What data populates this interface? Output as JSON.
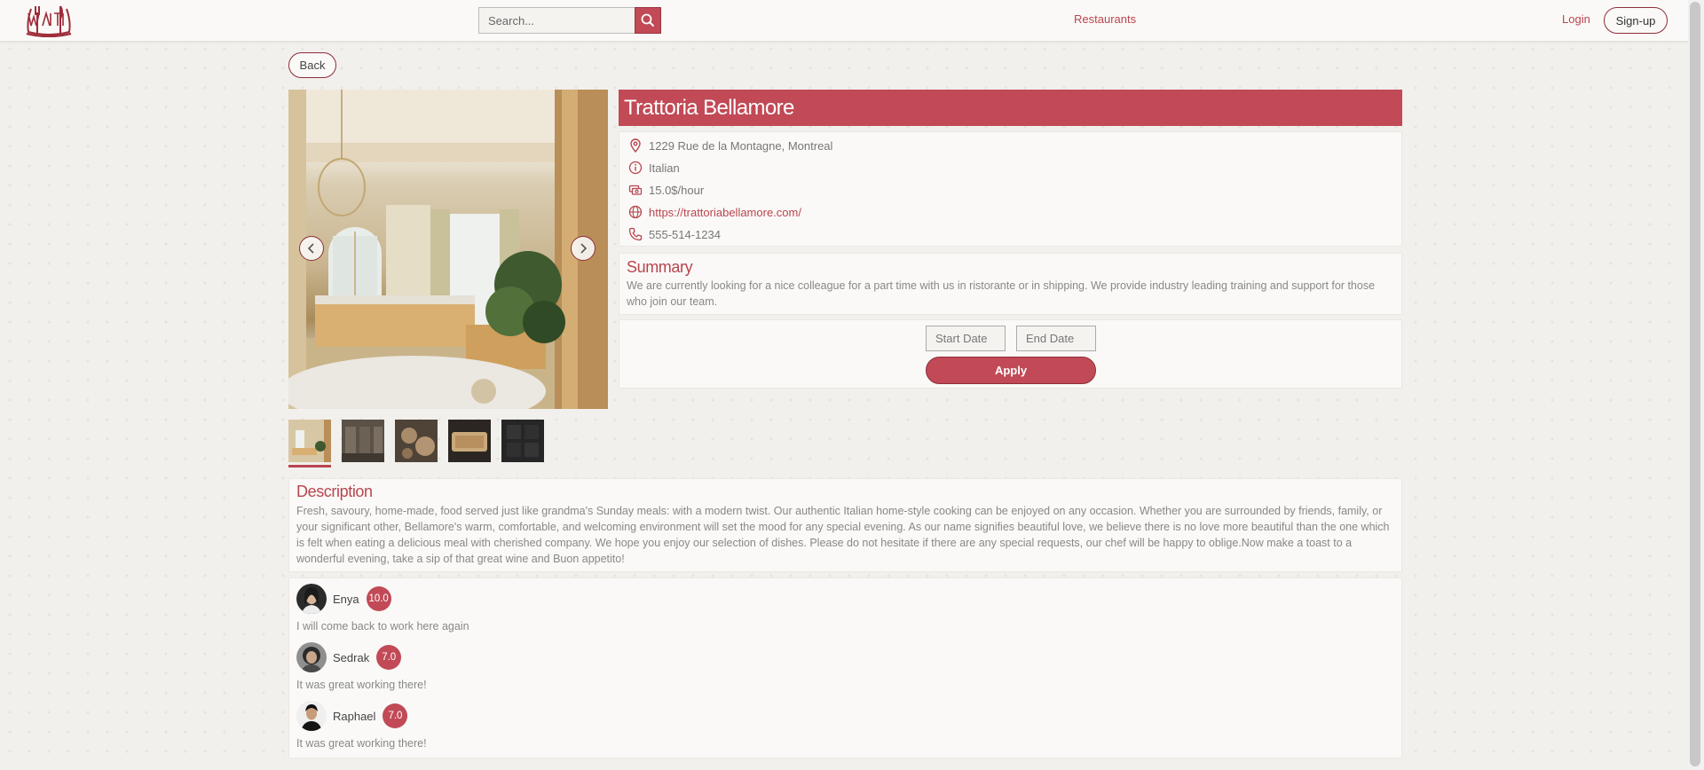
{
  "nav": {
    "search_placeholder": "Search...",
    "restaurants_link": "Restaurants",
    "login_link": "Login",
    "signup_label": "Sign-up"
  },
  "back_label": "Back",
  "restaurant": {
    "name": "Trattoria Bellamore",
    "address": "1229 Rue de la Montagne, Montreal",
    "cuisine": "Italian",
    "rate": "15.0$/hour",
    "website": "https://trattoriabellamore.com/",
    "phone": "555-514-1234"
  },
  "gallery": {
    "thumbnail_count": 5,
    "active_index": 0
  },
  "summary": {
    "title": "Summary",
    "text": "We are currently looking for a nice colleague for a part time with us in ristorante or in shipping. We provide industry leading training and support for those who join our team."
  },
  "apply": {
    "start_date_placeholder": "Start Date",
    "end_date_placeholder": "End Date",
    "apply_label": "Apply"
  },
  "description": {
    "title": "Description",
    "text": "Fresh, savoury, home-made, food served just like grandma's Sunday meals: with a modern twist. Our authentic Italian home-style cooking can be enjoyed on any occasion. Whether you are surrounded by friends, family, or your significant other, Bellamore's warm, comfortable, and welcoming environment will set the mood for any special evening. As our name signifies beautiful love, we believe there is no love more beautiful than the one which is felt when eating a delicious meal with cherished company. We hope you enjoy our selection of dishes. Please do not hesitate if there are any special requests, our chef will be happy to oblige.Now make a toast to a wonderful evening, take a sip of that great wine and Buon appetito!"
  },
  "reviews": [
    {
      "name": "Enya",
      "rating": "10.0",
      "text": "I will come back to work here again"
    },
    {
      "name": "Sedrak",
      "rating": "7.0",
      "text": "It was great working there!"
    },
    {
      "name": "Raphael",
      "rating": "7.0",
      "text": "It was great working there!"
    }
  ],
  "colors": {
    "accent": "#c14a56",
    "accent_dark": "#8e2e38",
    "background": "#f2f0ec",
    "panel": "#faf9f7"
  },
  "icons": {
    "logo": "waitist-logo",
    "search": "search-icon",
    "address": "map-pin-icon",
    "cuisine": "info-icon",
    "rate": "money-icon",
    "website": "globe-icon",
    "phone": "phone-icon",
    "prev": "chevron-left-icon",
    "next": "chevron-right-icon"
  }
}
